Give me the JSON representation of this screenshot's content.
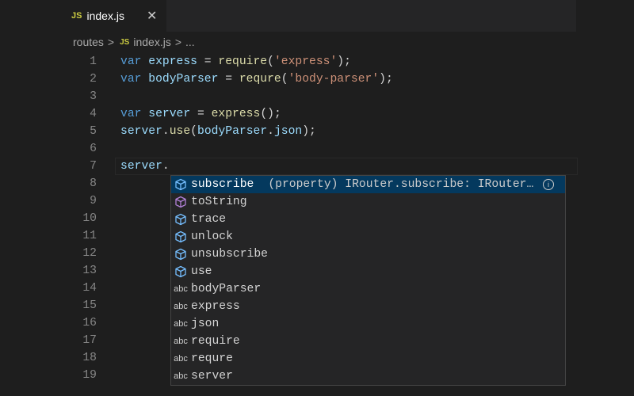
{
  "tab": {
    "icon": "JS",
    "name": "index.js",
    "close": "✕"
  },
  "breadcrumb": {
    "folder": "routes",
    "sep": ">",
    "icon": "JS",
    "file": "index.js",
    "more": "..."
  },
  "colors": {
    "keyword": "#569cd6",
    "variable": "#9cdcfe",
    "function": "#dcdcaa",
    "string": "#ce9178",
    "selection": "#04395e"
  },
  "code_lines": [
    {
      "n": "1",
      "tokens": [
        [
          "kw",
          "var "
        ],
        [
          "var",
          "express"
        ],
        [
          "op",
          " = "
        ],
        [
          "fn",
          "require"
        ],
        [
          "op",
          "("
        ],
        [
          "str",
          "'express'"
        ],
        [
          "op",
          ");"
        ]
      ]
    },
    {
      "n": "2",
      "tokens": [
        [
          "kw",
          "var "
        ],
        [
          "var",
          "bodyParser"
        ],
        [
          "op",
          " = "
        ],
        [
          "fn",
          "requre"
        ],
        [
          "op",
          "("
        ],
        [
          "str",
          "'body-parser'"
        ],
        [
          "op",
          ");"
        ]
      ]
    },
    {
      "n": "3",
      "tokens": []
    },
    {
      "n": "4",
      "tokens": [
        [
          "kw",
          "var "
        ],
        [
          "var",
          "server"
        ],
        [
          "op",
          " = "
        ],
        [
          "fn",
          "express"
        ],
        [
          "op",
          "();"
        ]
      ]
    },
    {
      "n": "5",
      "tokens": [
        [
          "var",
          "server"
        ],
        [
          "op",
          "."
        ],
        [
          "fn",
          "use"
        ],
        [
          "op",
          "("
        ],
        [
          "var",
          "bodyParser"
        ],
        [
          "op",
          "."
        ],
        [
          "var",
          "json"
        ],
        [
          "op",
          ");"
        ]
      ]
    },
    {
      "n": "6",
      "tokens": []
    },
    {
      "n": "7",
      "tokens": [
        [
          "var",
          "server"
        ],
        [
          "op",
          "."
        ]
      ]
    },
    {
      "n": "8",
      "tokens": []
    },
    {
      "n": "9",
      "tokens": []
    },
    {
      "n": "10",
      "tokens": []
    },
    {
      "n": "11",
      "tokens": []
    },
    {
      "n": "12",
      "tokens": []
    },
    {
      "n": "13",
      "tokens": []
    },
    {
      "n": "14",
      "tokens": []
    },
    {
      "n": "15",
      "tokens": []
    },
    {
      "n": "16",
      "tokens": []
    },
    {
      "n": "17",
      "tokens": []
    },
    {
      "n": "18",
      "tokens": []
    },
    {
      "n": "19",
      "tokens": []
    }
  ],
  "suggestions": [
    {
      "label": "subscribe",
      "kind": "property",
      "detail": "(property) IRouter.subscribe: IRouter…",
      "selected": true
    },
    {
      "label": "toString",
      "kind": "method"
    },
    {
      "label": "trace",
      "kind": "property"
    },
    {
      "label": "unlock",
      "kind": "property"
    },
    {
      "label": "unsubscribe",
      "kind": "property"
    },
    {
      "label": "use",
      "kind": "property"
    },
    {
      "label": "bodyParser",
      "kind": "text",
      "icon": "abc"
    },
    {
      "label": "express",
      "kind": "text",
      "icon": "abc"
    },
    {
      "label": "json",
      "kind": "text",
      "icon": "abc"
    },
    {
      "label": "require",
      "kind": "text",
      "icon": "abc"
    },
    {
      "label": "requre",
      "kind": "text",
      "icon": "abc"
    },
    {
      "label": "server",
      "kind": "text",
      "icon": "abc"
    }
  ],
  "info_icon": "i"
}
